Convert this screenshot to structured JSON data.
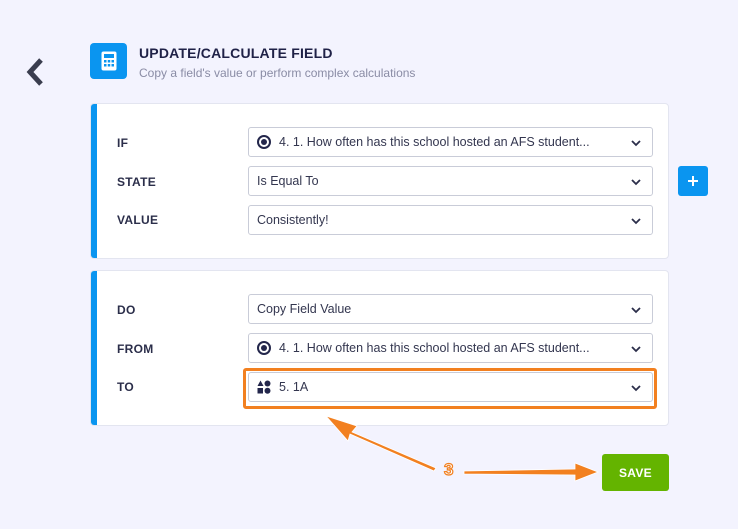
{
  "header": {
    "title": "UPDATE/CALCULATE FIELD",
    "subtitle": "Copy a field's value or perform complex calculations",
    "icon": "calculator-icon"
  },
  "condition": {
    "if_label": "IF",
    "if_value": "4. 1. How often has this school hosted an AFS student...",
    "state_label": "STATE",
    "state_value": "Is Equal To",
    "value_label": "VALUE",
    "value_value": "Consistently!"
  },
  "action": {
    "do_label": "DO",
    "do_value": "Copy Field Value",
    "from_label": "FROM",
    "from_value": "4. 1. How often has this school hosted an AFS student...",
    "to_label": "TO",
    "to_value": "5. 1A"
  },
  "add_button_label": "+",
  "save_label": "SAVE",
  "annotation": {
    "step_number": "3",
    "color": "#f28020"
  },
  "colors": {
    "accent": "#0a95f0",
    "save": "#64b400",
    "background": "#f3f3fe"
  }
}
